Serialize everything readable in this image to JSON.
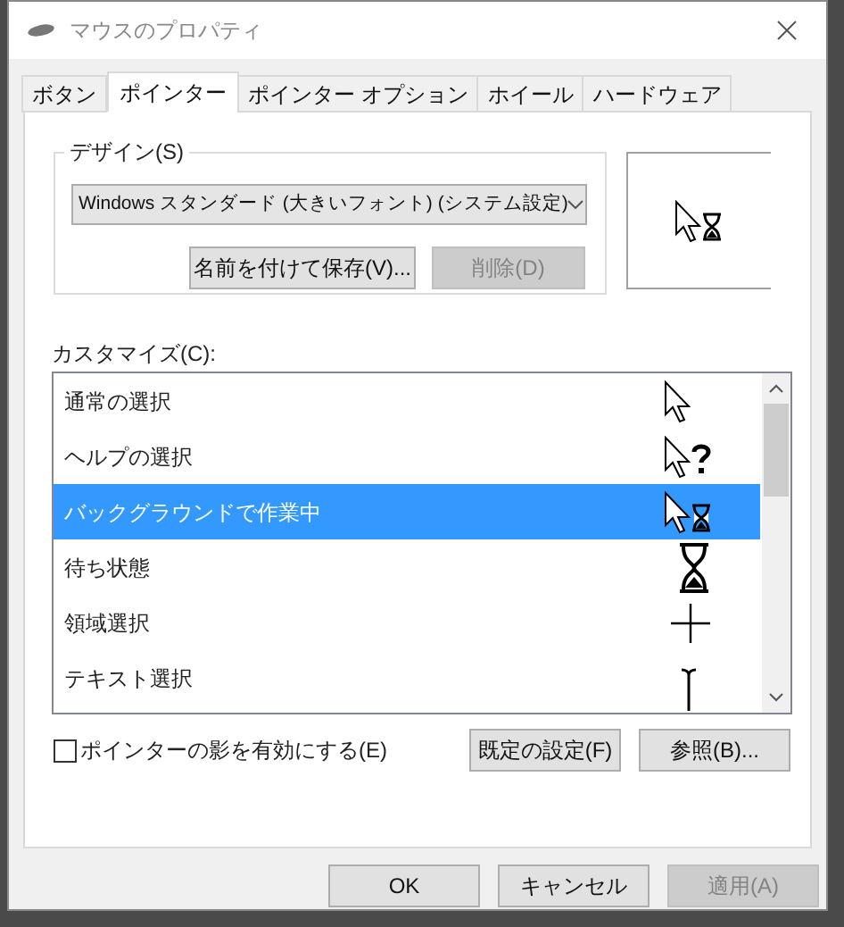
{
  "window": {
    "title": "マウスのプロパティ"
  },
  "tabs": [
    {
      "label": "ボタン",
      "selected": false
    },
    {
      "label": "ポインター",
      "selected": true
    },
    {
      "label": "ポインター オプション",
      "selected": false
    },
    {
      "label": "ホイール",
      "selected": false
    },
    {
      "label": "ハードウェア",
      "selected": false
    }
  ],
  "design": {
    "label": "デザイン(S)",
    "scheme": "Windows スタンダード (大きいフォント) (システム設定)",
    "save_button": {
      "label": "名前を付けて保存(V)...",
      "disabled": false
    },
    "delete_button": {
      "label": "削除(D)",
      "disabled": true
    }
  },
  "customize": {
    "label": "カスタマイズ(C):",
    "rows": [
      {
        "label": "通常の選択",
        "kind": "arrow",
        "selected": false
      },
      {
        "label": "ヘルプの選択",
        "kind": "help",
        "selected": false
      },
      {
        "label": "バックグラウンドで作業中",
        "kind": "busy",
        "selected": true
      },
      {
        "label": "待ち状態",
        "kind": "hourglass",
        "selected": false
      },
      {
        "label": "領域選択",
        "kind": "cross",
        "selected": false
      },
      {
        "label": "テキスト選択",
        "kind": "beam",
        "selected": false
      }
    ]
  },
  "shadow_checkbox": {
    "label": "ポインターの影を有効にする(E)",
    "checked": false
  },
  "buttons": [
    {
      "label": "既定の設定(F)",
      "disabled": false
    },
    {
      "label": "参照(B)...",
      "disabled": false
    }
  ],
  "footer_buttons": [
    {
      "label": "OK",
      "disabled": false
    },
    {
      "label": "キャンセル",
      "disabled": false
    },
    {
      "label": "適用(A)",
      "disabled": true
    }
  ]
}
